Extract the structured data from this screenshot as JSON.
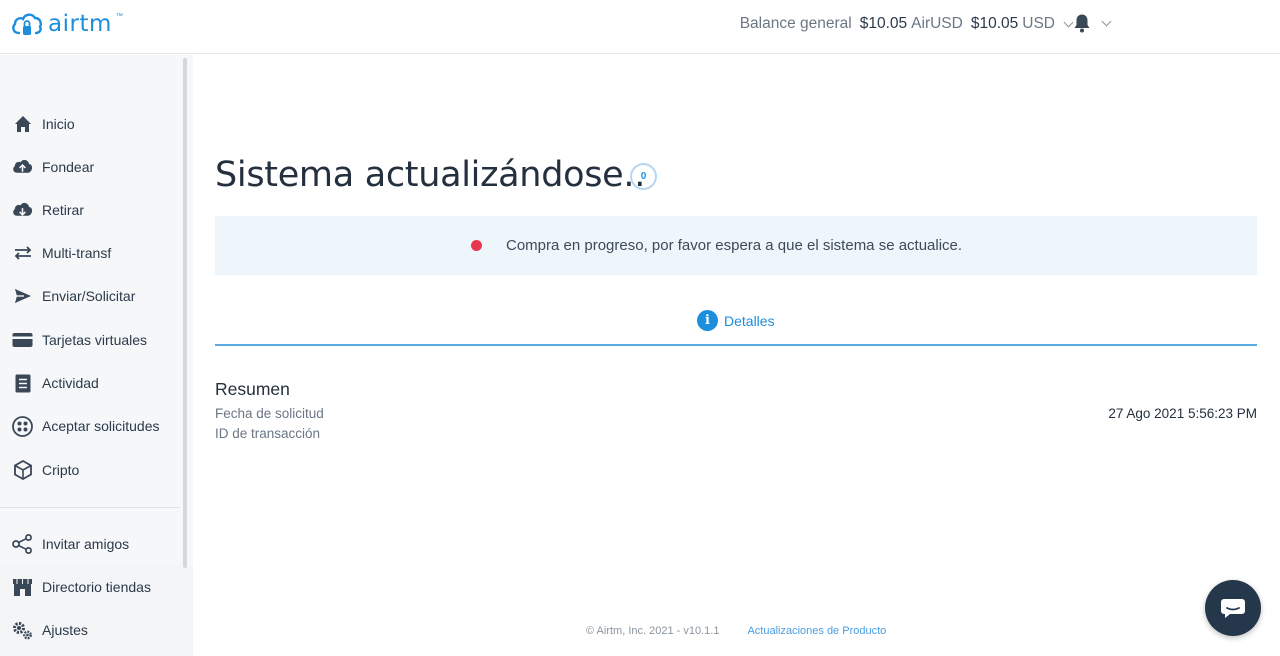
{
  "header": {
    "logo_text": "airtm",
    "logo_tm": "™",
    "balance_label": "Balance general",
    "balance_airusd_amount": "$10.05",
    "balance_airusd_unit": "AirUSD",
    "balance_usd_amount": "$10.05",
    "balance_usd_unit": "USD"
  },
  "sidebar": {
    "items": [
      {
        "label": "Inicio",
        "icon": "home-icon"
      },
      {
        "label": "Fondear",
        "icon": "cloud-upload-icon"
      },
      {
        "label": "Retirar",
        "icon": "cloud-download-icon"
      },
      {
        "label": "Multi-transf",
        "icon": "arrows-swap-icon"
      },
      {
        "label": "Enviar/Solicitar",
        "icon": "send-icon"
      },
      {
        "label": "Tarjetas virtuales",
        "icon": "credit-card-icon"
      },
      {
        "label": "Actividad",
        "icon": "document-list-icon"
      },
      {
        "label": "Aceptar solicitudes",
        "icon": "grid-dots-icon"
      },
      {
        "label": "Cripto",
        "icon": "cube-icon"
      }
    ],
    "bottom_items": [
      {
        "label": "Invitar amigos",
        "icon": "share-icon"
      },
      {
        "label": "Directorio tiendas",
        "icon": "store-icon"
      },
      {
        "label": "Ajustes",
        "icon": "gears-icon"
      }
    ]
  },
  "main": {
    "title": "Sistema actualizándose..",
    "spinner_value": "0",
    "alert_text": "Compra en progreso, por favor espera a que el sistema se actualice.",
    "tab_label": "Detalles",
    "summary": {
      "title": "Resumen",
      "request_date_label": "Fecha de solicitud",
      "request_date_value": "27 Ago 2021 5:56:23 PM",
      "transaction_id_label": "ID de transacción"
    }
  },
  "footer": {
    "copyright": "© Airtm, Inc. 2021 - v10.1.1",
    "updates_link": "Actualizaciones de Producto"
  },
  "colors": {
    "brand": "#1c8ede",
    "alert_bg": "#eef6fc",
    "alert_dot": "#e8364f",
    "chat_bg": "#25374a"
  }
}
